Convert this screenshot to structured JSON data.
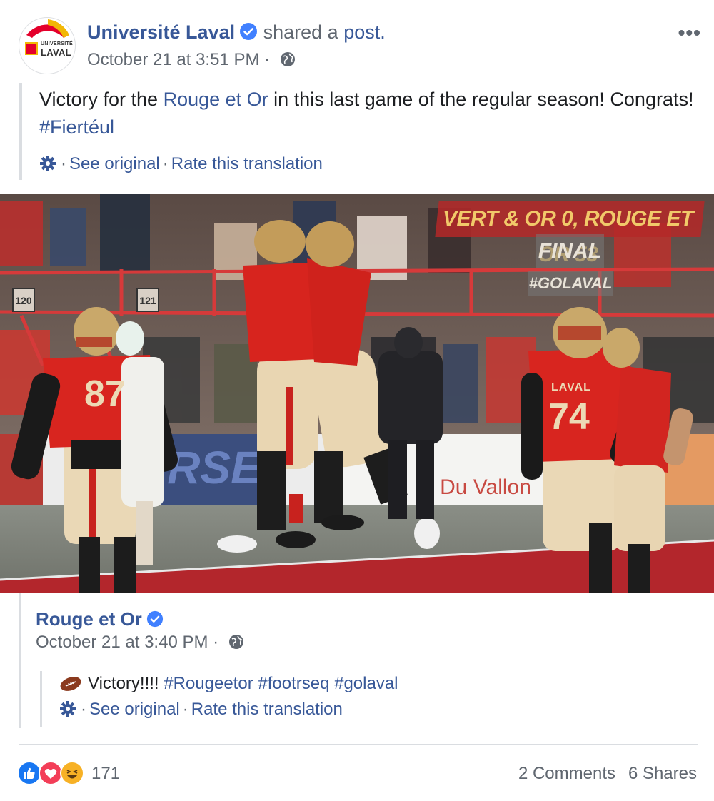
{
  "post": {
    "author": "Université Laval",
    "action_text": "shared a",
    "action_link": "post.",
    "timestamp": "October 21 at 3:51 PM",
    "separator": "·",
    "avatar": {
      "line1": "UNIVERSITÉ",
      "line2": "LAVAL"
    },
    "more_label": "•••",
    "translated_text": {
      "prefix": "Victory for the ",
      "link": "Rouge et Or",
      "middle": " in this last game of the regular season! Congrats! ",
      "hashtag": "#Fiertéul"
    },
    "translation_actions": {
      "see_original": "See original",
      "rate": "Rate this translation"
    }
  },
  "photo": {
    "overlay_title": "VERT & OR 0, ROUGE ET OR 53",
    "overlay_final": "FINAL",
    "overlay_tag": "#GOLAVAL",
    "jersey_left": "87",
    "jersey_right": "74",
    "jersey_right_name": "LAVAL",
    "banner_text": "Du Vallon",
    "banner_left": "RSE",
    "section_a": "120",
    "section_b": "121"
  },
  "original_post": {
    "author": "Rouge et Or",
    "timestamp": "October 21 at 3:40 PM",
    "separator": "·",
    "text": {
      "plain": "Victory!!!! ",
      "hashtags": "#Rougeetor #footrseq #golaval"
    },
    "translation_actions": {
      "see_original": "See original",
      "rate": "Rate this translation"
    }
  },
  "footer": {
    "reaction_count": "171",
    "comments": "2 Comments",
    "shares": "6 Shares",
    "colors": {
      "like": "#1877f2",
      "love": "#f33e58",
      "haha": "#f7b125"
    }
  },
  "colors": {
    "link": "#385898",
    "muted": "#606770",
    "verified": "#4080ff",
    "laval_red": "#e4002b",
    "laval_gold": "#f2b705"
  }
}
